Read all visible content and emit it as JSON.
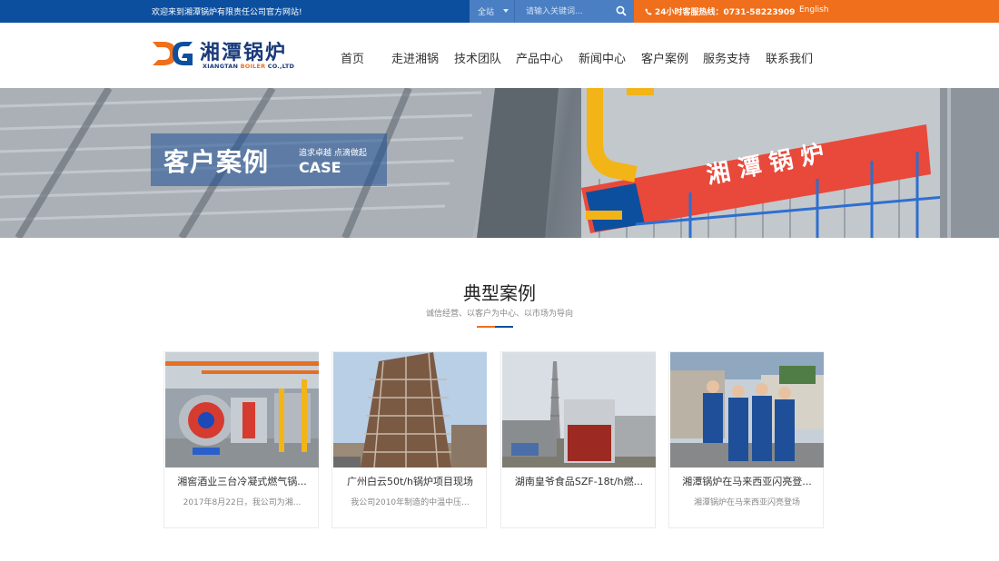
{
  "topbar": {
    "welcome": "欢迎来到湘潭锅炉有限责任公司官方网站!",
    "search_scope": "全站",
    "search_placeholder": "请输入关键词...",
    "hotline": "24小时客服热线：0731-58223909",
    "language": "English"
  },
  "header": {
    "logo_cn": "湘潭锅炉",
    "logo_en_prefix": "XIANGTAN ",
    "logo_en_accent": "BOILER",
    "logo_en_suffix": " CO.,LTD"
  },
  "nav": [
    "首页",
    "走进湘锅",
    "技术团队",
    "产品中心",
    "新闻中心",
    "客户案例",
    "服务支持",
    "联系我们"
  ],
  "banner": {
    "title": "客户案例",
    "slogan": "追求卓越 点滴做起",
    "title_en": "CASE",
    "sign_text": "湘 潭 锅 炉"
  },
  "section": {
    "title": "典型案例",
    "subtitle": "诚信经营、以客户为中心、以市场为导向"
  },
  "cards": [
    {
      "title": "湘窖酒业三台冷凝式燃气锅...",
      "desc": "2017年8月22日，我公司为湘...",
      "image": "boiler-room-photo"
    },
    {
      "title": "广州白云50t/h锅炉项目现场",
      "desc": "我公司2010年制造的中温中压...",
      "image": "boiler-tower-photo"
    },
    {
      "title": "湖南皇爷食品SZF-18t/h燃...",
      "desc": "",
      "image": "factory-chimney-photo"
    },
    {
      "title": "湘潭锅炉在马来西亚闪亮登...",
      "desc": "湘潭锅炉在马来西亚闪亮登场",
      "image": "team-photo"
    }
  ],
  "colors": {
    "brand_blue": "#0c4f9e",
    "brand_orange": "#ef6f1c"
  }
}
